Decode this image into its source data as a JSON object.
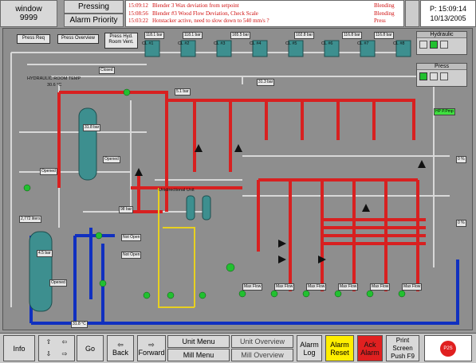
{
  "header": {
    "window_label": "window",
    "window_number": "9999",
    "pressing_label": "Pressing",
    "alarm_priority_label": "Alarm Priority",
    "alarms": [
      {
        "time": "15:09:12",
        "message": "Blender 3 Wax deviation from setpoint",
        "source": "Blending"
      },
      {
        "time": "15:08:56",
        "message": "Blender #3 Wood Flow Deviation, Check Scale",
        "source": "Blending"
      },
      {
        "time": "15:03:22",
        "message": "Hotstacker active, need to slow down to 540 mm/s ?",
        "source": "Press"
      }
    ],
    "clock_time": "P: 15:09:14",
    "clock_date": "10/13/2005"
  },
  "buttons": {
    "press_req": "Press Req",
    "press_overview": "Press Overview",
    "press_hyd_room_vent": "Press Hyd. Room Vent."
  },
  "tanks": [
    "CL #1",
    "CL #2",
    "CL #3",
    "CL #4",
    "CL #5",
    "CL #6",
    "CL #7",
    "CL #8"
  ],
  "pressures_top": [
    "118.1 bar",
    "118.1 bar",
    "165.5 bar",
    "102.8 bar",
    "116.8 bar",
    "116.8 bar"
  ],
  "labels": {
    "closed": "Closed",
    "hyd_room_temp": "HYDRAULIC ROOM TEMP",
    "room_temp_value": "30.6 °C",
    "bar_31": "31.3 bar",
    "bar_51": "5.1 bar",
    "bar_318": "31.8 bar",
    "opened1": "Opened",
    "opened2": "Opened",
    "opened3": "Opened",
    "bar_98": "98 bar",
    "level_2772": "2,772 liters",
    "bar_45": "4.5 bar",
    "not_open1": "Not Open",
    "not_open2": "Not Open",
    "unidirectional": "Unidirectional Unit",
    "temp_bottom": "31.8 °C",
    "pct_0": "0 %",
    "pct_0b": "0 %",
    "hp_press": "HP P.Pmp",
    "max_flow": "Max Flow"
  },
  "side_panels": {
    "hydraulic": "Hydraulic",
    "press": "Press"
  },
  "bottom": {
    "info": "Info",
    "go": "Go",
    "back": "Back",
    "forward": "Forward",
    "unit_menu": "Unit Menu",
    "unit_overview": "Unit Overview",
    "mill_menu": "Mill Menu",
    "mill_overview": "Mill Overview",
    "alarm_log": "Alarm Log",
    "alarm_reset": "Alarm Reset",
    "ack_alarm": "Ack Alarm",
    "print_screen": "Print Screen Push F9",
    "logo_text": "P2S"
  },
  "colors": {
    "hyd_red": "#d82020",
    "hyd_blue": "#1030c0",
    "yellow_line": "#e8d020",
    "tank_teal": "#3d8f8f",
    "alarm_reset_bg": "#ffee00",
    "ack_alarm_bg": "#e02020"
  }
}
